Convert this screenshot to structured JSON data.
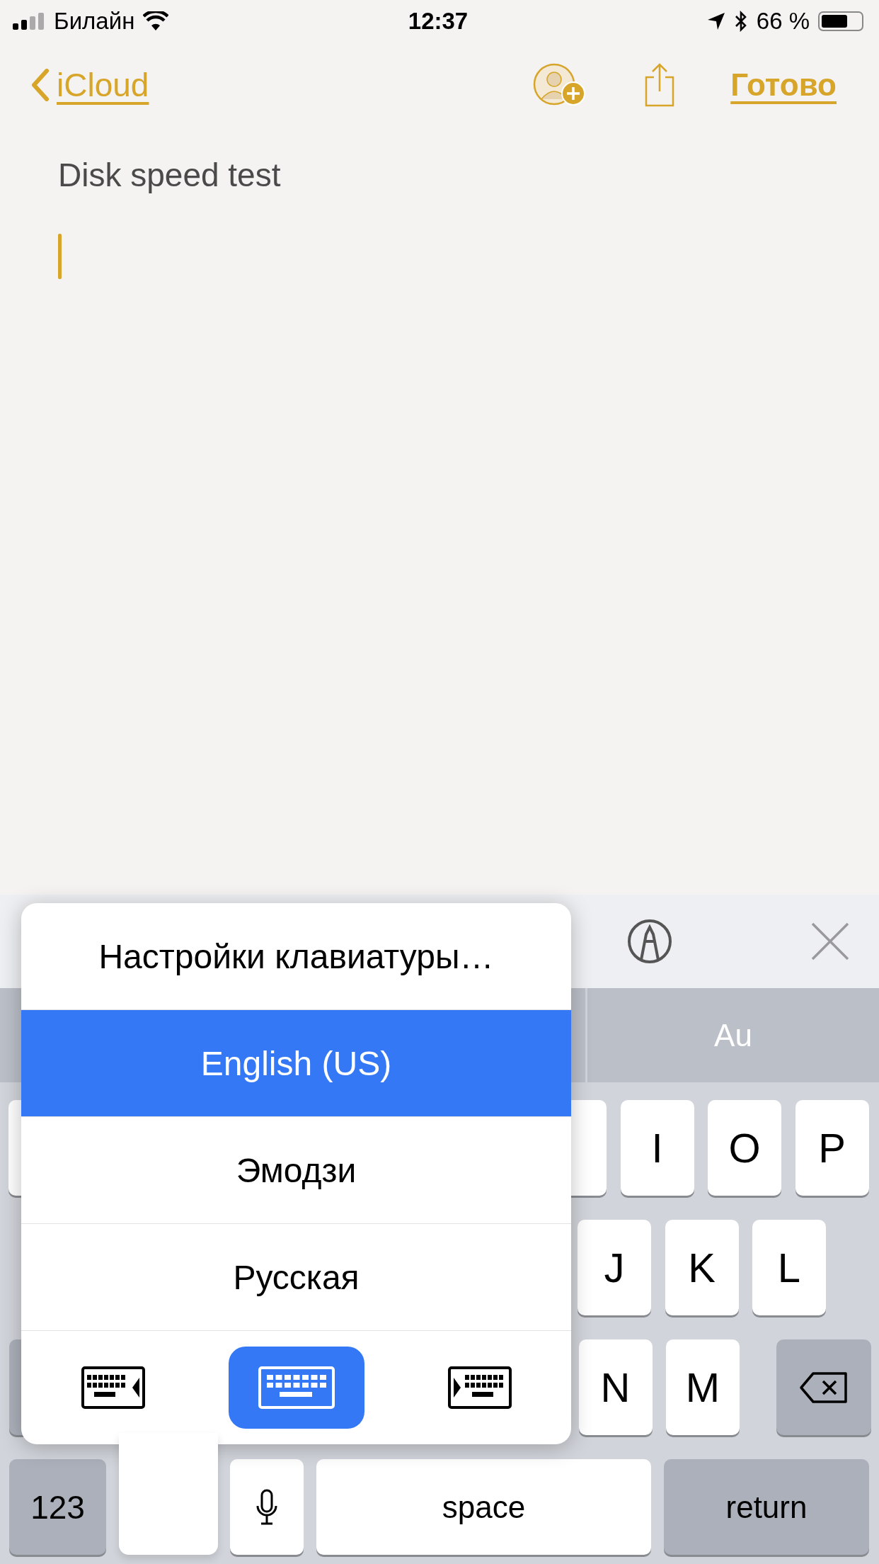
{
  "status_bar": {
    "carrier": "Билайн",
    "time": "12:37",
    "battery_percent": "66 %"
  },
  "nav": {
    "back": "iCloud",
    "done": "Готово"
  },
  "note": {
    "title": "Disk speed test"
  },
  "suggestions": [
    "Au"
  ],
  "keyboard_rows": [
    [
      {
        "kind": "covered"
      },
      {
        "kind": "covered"
      },
      {
        "kind": "letter",
        "label": "I"
      },
      {
        "kind": "letter",
        "label": "O"
      },
      {
        "kind": "letter",
        "label": "P"
      }
    ],
    [
      {
        "kind": "letter",
        "label": "J"
      },
      {
        "kind": "letter",
        "label": "K"
      },
      {
        "kind": "letter",
        "label": "L"
      }
    ],
    [
      {
        "kind": "covered-shift"
      },
      {
        "kind": "letter",
        "label": "N"
      },
      {
        "kind": "letter",
        "label": "M"
      },
      {
        "kind": "backspace"
      }
    ],
    [
      {
        "kind": "mode",
        "label": "123"
      },
      {
        "kind": "mic"
      },
      {
        "kind": "space",
        "label": "space"
      },
      {
        "kind": "return",
        "label": "return"
      }
    ]
  ],
  "popup": {
    "settings": "Настройки клавиатуры…",
    "options": [
      {
        "label": "English (US)",
        "selected": true
      },
      {
        "label": "Эмодзи",
        "selected": false
      },
      {
        "label": "Русская",
        "selected": false
      }
    ],
    "layouts": [
      {
        "kind": "left",
        "selected": false
      },
      {
        "kind": "full",
        "selected": true
      },
      {
        "kind": "right",
        "selected": false
      }
    ]
  }
}
